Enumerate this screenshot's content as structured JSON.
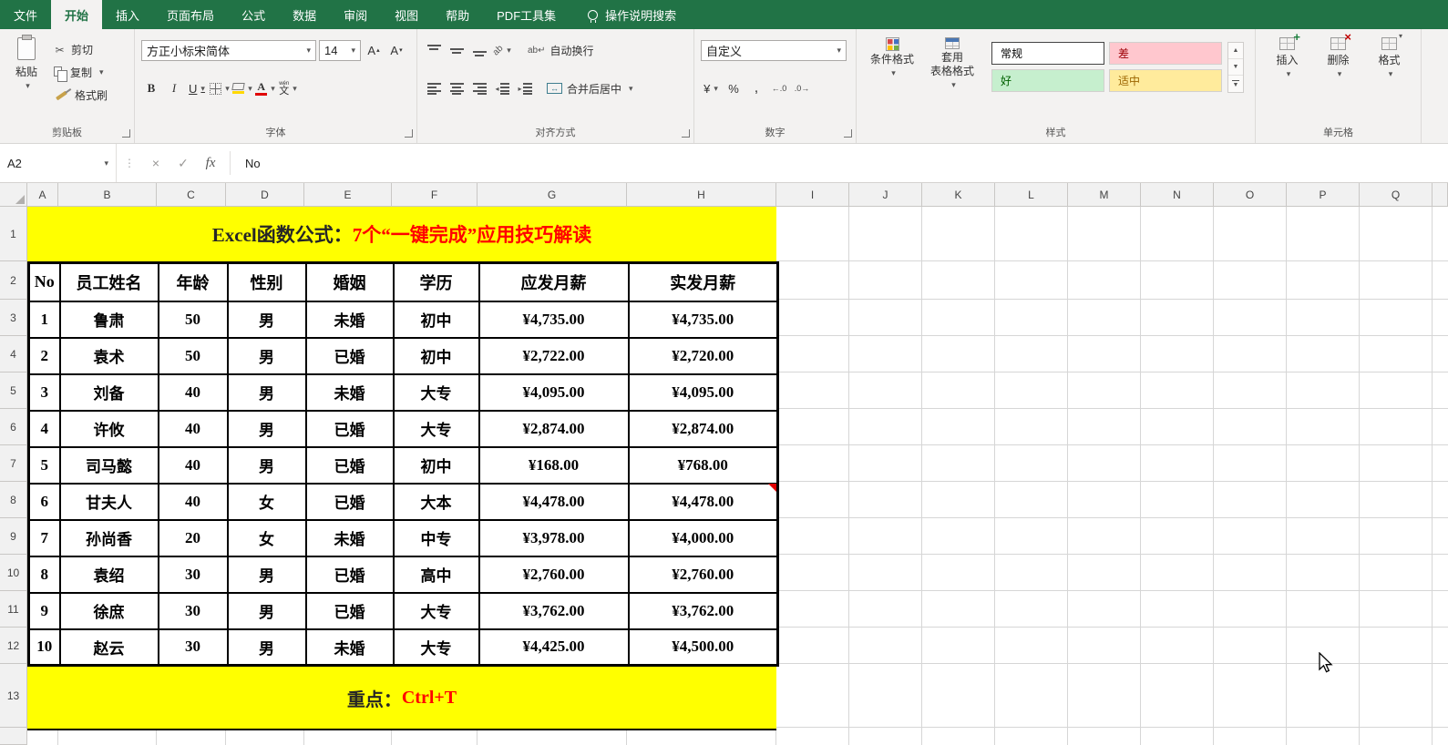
{
  "tabs": {
    "items": [
      {
        "label": "文件",
        "active": false
      },
      {
        "label": "开始",
        "active": true
      },
      {
        "label": "插入",
        "active": false
      },
      {
        "label": "页面布局",
        "active": false
      },
      {
        "label": "公式",
        "active": false
      },
      {
        "label": "数据",
        "active": false
      },
      {
        "label": "审阅",
        "active": false
      },
      {
        "label": "视图",
        "active": false
      },
      {
        "label": "帮助",
        "active": false
      },
      {
        "label": "PDF工具集",
        "active": false
      }
    ],
    "search_label": "操作说明搜索"
  },
  "ribbon": {
    "clipboard": {
      "label": "剪贴板",
      "paste": "粘贴",
      "cut": "剪切",
      "copy": "复制",
      "format_painter": "格式刷"
    },
    "font": {
      "label": "字体",
      "font_name": "方正小标宋简体",
      "font_size": "14"
    },
    "alignment": {
      "label": "对齐方式",
      "wrap_text": "自动换行",
      "merge_center": "合并后居中"
    },
    "number": {
      "label": "数字",
      "format": "自定义"
    },
    "styles": {
      "label": "样式",
      "conditional": "条件格式",
      "table_format_line1": "套用",
      "table_format_line2": "表格格式",
      "chips": [
        {
          "label": "常规",
          "bg": "#ffffff",
          "fg": "#000000",
          "selected": true
        },
        {
          "label": "差",
          "bg": "#ffc7ce",
          "fg": "#9c0006",
          "selected": false
        },
        {
          "label": "好",
          "bg": "#c6efce",
          "fg": "#006100",
          "selected": false
        },
        {
          "label": "适中",
          "bg": "#ffeb9c",
          "fg": "#9c6500",
          "selected": false
        }
      ]
    },
    "cells": {
      "label": "单元格",
      "insert": "插入",
      "delete": "删除",
      "format": "格式"
    }
  },
  "formula_bar": {
    "name_box": "A2",
    "value": "No"
  },
  "sheet": {
    "col_headers": [
      "A",
      "B",
      "C",
      "D",
      "E",
      "F",
      "G",
      "H",
      "I",
      "J",
      "K",
      "L",
      "M",
      "N",
      "O",
      "P",
      "Q"
    ],
    "row_headers": [
      "1",
      "2",
      "3",
      "4",
      "5",
      "6",
      "7",
      "8",
      "9",
      "10",
      "11",
      "12",
      "13"
    ],
    "title": {
      "prefix": "Excel函数公式：",
      "highlight": "7个“一键完成”应用技巧解读"
    },
    "table": {
      "headers": [
        "No",
        "员工姓名",
        "年龄",
        "性别",
        "婚姻",
        "学历",
        "应发月薪",
        "实发月薪"
      ],
      "rows": [
        [
          "1",
          "鲁肃",
          "50",
          "男",
          "未婚",
          "初中",
          "¥4,735.00",
          "¥4,735.00"
        ],
        [
          "2",
          "袁术",
          "50",
          "男",
          "已婚",
          "初中",
          "¥2,722.00",
          "¥2,720.00"
        ],
        [
          "3",
          "刘备",
          "40",
          "男",
          "未婚",
          "大专",
          "¥4,095.00",
          "¥4,095.00"
        ],
        [
          "4",
          "许攸",
          "40",
          "男",
          "已婚",
          "大专",
          "¥2,874.00",
          "¥2,874.00"
        ],
        [
          "5",
          "司马懿",
          "40",
          "男",
          "已婚",
          "初中",
          "¥168.00",
          "¥768.00"
        ],
        [
          "6",
          "甘夫人",
          "40",
          "女",
          "已婚",
          "大本",
          "¥4,478.00",
          "¥4,478.00"
        ],
        [
          "7",
          "孙尚香",
          "20",
          "女",
          "未婚",
          "中专",
          "¥3,978.00",
          "¥4,000.00"
        ],
        [
          "8",
          "袁绍",
          "30",
          "男",
          "已婚",
          "高中",
          "¥2,760.00",
          "¥2,760.00"
        ],
        [
          "9",
          "徐庶",
          "30",
          "男",
          "已婚",
          "大专",
          "¥3,762.00",
          "¥3,762.00"
        ],
        [
          "10",
          "赵云",
          "30",
          "男",
          "未婚",
          "大专",
          "¥4,425.00",
          "¥4,500.00"
        ]
      ]
    },
    "footer": {
      "prefix": "重点：",
      "highlight": "Ctrl+T"
    }
  },
  "colors": {
    "excel_green": "#217346",
    "band_bg": "#ffff00",
    "highlight_text": "#ff0000"
  }
}
